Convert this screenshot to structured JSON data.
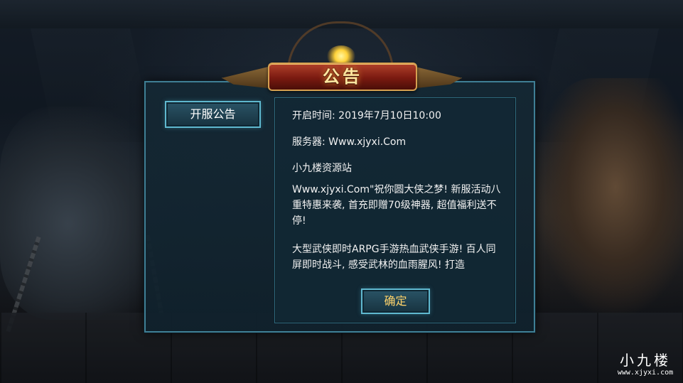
{
  "dialog": {
    "title": "公告",
    "tabs": [
      {
        "label": "开服公告"
      }
    ],
    "content": {
      "open_time": "开启时间: 2019年7月10日10:00",
      "server": "服务器: Www.xjyxi.Com",
      "site": "小九楼资源站",
      "promo": "Www.xjyxi.Com\"祝你圆大侠之梦! 新服活动八重特惠来袭, 首充即赠70级神器, 超值福利送不停!",
      "intro": "大型武侠即时ARPG手游热血武侠手游! 百人同屏即时战斗, 感受武林的血雨腥风! 打造"
    },
    "confirm_label": "确定"
  },
  "watermark": {
    "main": "小九楼",
    "sub": "www.xjyxi.com"
  },
  "colors": {
    "frame": "#3f7f95",
    "title_plate": "#7a1a10",
    "title_text": "#ffe7a0",
    "confirm_text": "#ffd36a"
  }
}
